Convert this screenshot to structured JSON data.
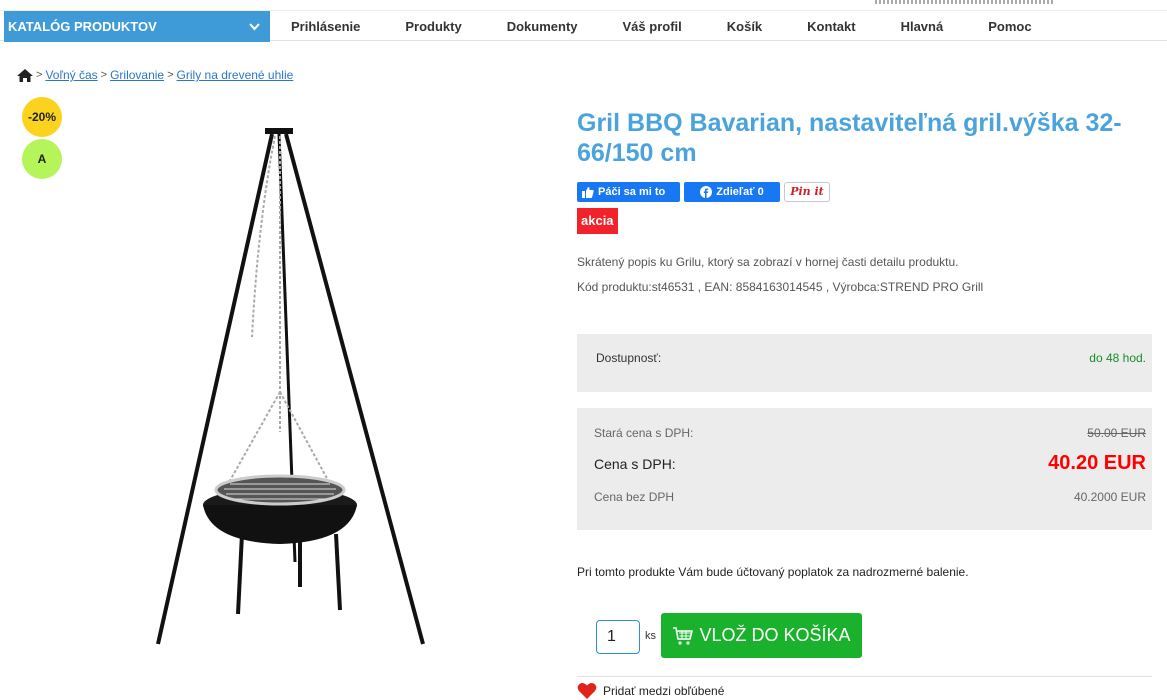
{
  "nav": {
    "catalog_label": "KATALÓG PRODUKTOV",
    "items": [
      "Prihlásenie",
      "Produkty",
      "Dokumenty",
      "Váš profil",
      "Košík",
      "Kontakt",
      "Hlavná",
      "Pomoc"
    ]
  },
  "breadcrumb": {
    "home_icon": "home-icon",
    "separator": ">",
    "items": [
      "Voľný čas",
      "Grilovanie",
      "Grily na drevené uhlie"
    ]
  },
  "badges": {
    "discount": "-20%",
    "energy": "A"
  },
  "product": {
    "title": "Gril BBQ Bavarian, nastaviteľná gril.výška 32-66/150 cm",
    "promo_label": "akcia",
    "short_description": "Skrátený popis ku Grilu, ktorý sa zobrazí v hornej časti detailu produktu.",
    "codes": "Kód produktu:st46531 , EAN: 8584163014545 , Výrobca:STREND PRO Grill",
    "image_icon": "charcoal-tripod-grill-image"
  },
  "social": {
    "like_label": "Páči sa mi to",
    "share_label": "Zdieľať 0",
    "pin_label": "Pin it"
  },
  "availability": {
    "label": "Dostupnosť:",
    "value": "do 48 hod."
  },
  "price": {
    "old_label": "Stará cena s DPH:",
    "old_value": "50.00 EUR",
    "label": "Cena s DPH:",
    "value": "40.20 EUR",
    "net_label": "Cena bez DPH",
    "net_value": "40.2000 EUR"
  },
  "oversize_note": "Pri tomto produkte Vám bude účtovaný poplatok za nadrozmerné balenie.",
  "cart": {
    "quantity": "1",
    "unit": "ks",
    "button_label": "VLOŽ DO KOŠÍKA"
  },
  "favorites_label": "Pridať medzi obľúbené",
  "colors": {
    "accent": "#3f9ad8",
    "title": "#4aa3dc",
    "price_red": "#ff0000",
    "cart_green": "#1ab22c",
    "promo_red": "#f3222a",
    "available_green": "#1a8a2a"
  }
}
